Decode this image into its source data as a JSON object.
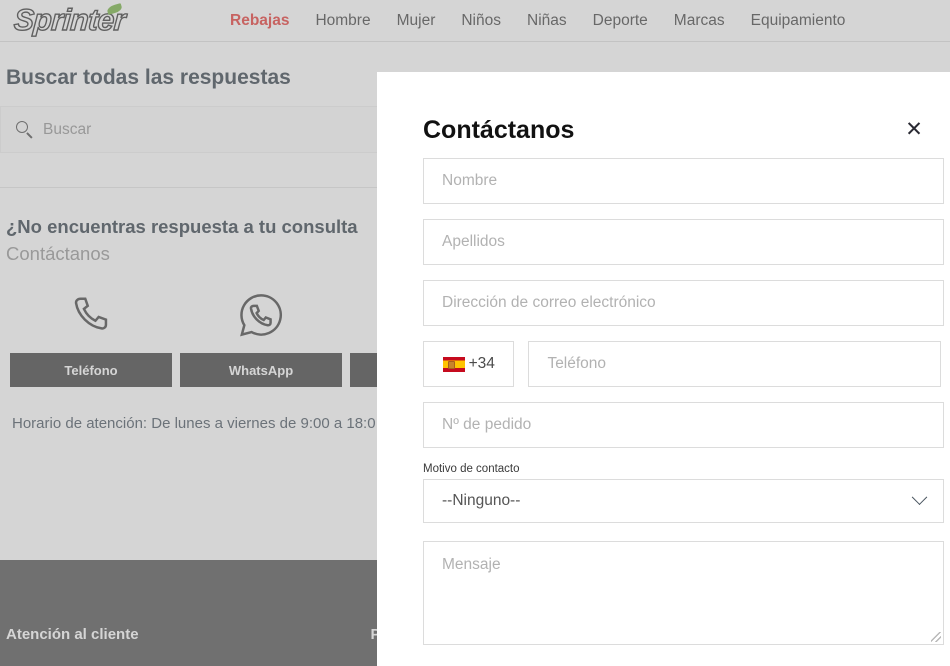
{
  "site": {
    "logo_text": "Sprinter",
    "nav": [
      {
        "label": "Rebajas",
        "highlight": true
      },
      {
        "label": "Hombre",
        "highlight": false
      },
      {
        "label": "Mujer",
        "highlight": false
      },
      {
        "label": "Niños",
        "highlight": false
      },
      {
        "label": "Niñas",
        "highlight": false
      },
      {
        "label": "Deporte",
        "highlight": false
      },
      {
        "label": "Marcas",
        "highlight": false
      },
      {
        "label": "Equipamiento",
        "highlight": false
      }
    ]
  },
  "faq": {
    "title": "Buscar todas las respuestas",
    "search_placeholder": "Buscar"
  },
  "contact_section": {
    "question": "¿No encuentras respuesta a tu consulta",
    "subtitle": "Contáctanos",
    "channels": [
      {
        "icon": "phone-icon",
        "label": "Teléfono"
      },
      {
        "icon": "whatsapp-icon",
        "label": "WhatsApp"
      },
      {
        "icon": "mail-icon",
        "label": ""
      }
    ],
    "hours": "Horario de atención: De lunes a viernes de 9:00 a 18:0"
  },
  "footer": {
    "columns": [
      {
        "title": "Atención al cliente"
      },
      {
        "title": "Promociones"
      }
    ]
  },
  "modal": {
    "title": "Contáctanos",
    "close_label": "✕",
    "fields": {
      "first_name": {
        "placeholder": "Nombre",
        "value": ""
      },
      "last_name": {
        "placeholder": "Apellidos",
        "value": ""
      },
      "email": {
        "placeholder": "Dirección de correo electrónico",
        "value": ""
      },
      "phone_prefix": {
        "value": "+34",
        "flag": "spain-flag-icon"
      },
      "phone": {
        "placeholder": "Teléfono",
        "value": ""
      },
      "order_number": {
        "placeholder": "Nº de pedido",
        "value": ""
      },
      "reason": {
        "label": "Motivo de contacto",
        "value": "--Ninguno--"
      },
      "message": {
        "placeholder": "Mensaje",
        "value": ""
      }
    }
  },
  "colors": {
    "sale_red": "#e8413f",
    "logo_green": "#7ab648",
    "button_dark": "#454545",
    "footer_dark": "#575757"
  }
}
